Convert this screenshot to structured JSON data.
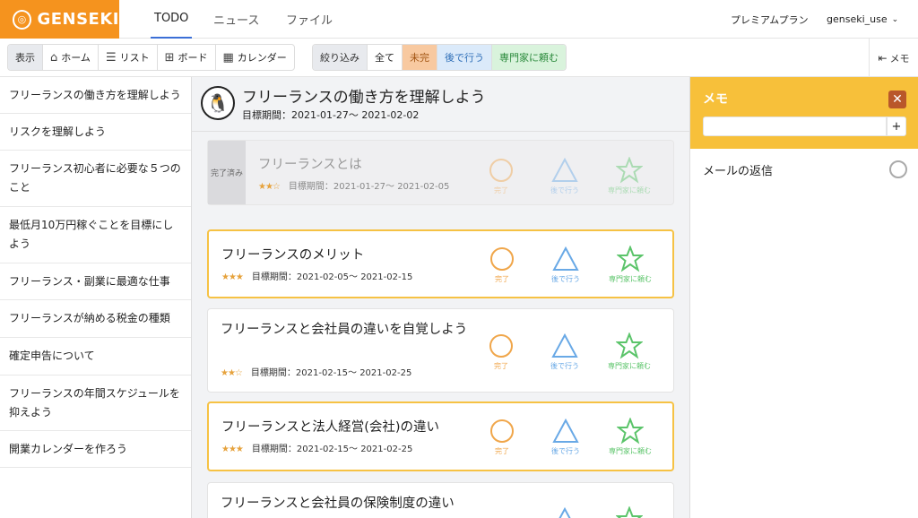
{
  "app": {
    "logo": "GENSEKI"
  },
  "topnav": {
    "items": [
      "TODO",
      "ニュース",
      "ファイル"
    ],
    "plan": "プレミアムプラン",
    "user": "genseki_use"
  },
  "toolbar": {
    "view_label": "表示",
    "views": [
      "ホーム",
      "リスト",
      "ボード",
      "カレンダー"
    ],
    "filter_label": "絞り込み",
    "filters": [
      "全て",
      "未完",
      "後で行う",
      "専門家に頼む"
    ],
    "memo_toggle": "メモ"
  },
  "sidebar": {
    "items": [
      "フリーランスの働き方を理解しよう",
      "リスクを理解しよう",
      "フリーランス初心者に必要な５つのこと",
      "最低月10万円稼ぐことを目標にしよう",
      "フリーランス・副業に最適な仕事",
      "フリーランスが納める税金の種類",
      "確定申告について",
      "フリーランスの年間スケジュールを抑えよう",
      "開業カレンダーを作ろう"
    ]
  },
  "course": {
    "title": "フリーランスの働き方を理解しよう",
    "period": "目標期間：2021-01-27〜 2021-02-02"
  },
  "actions": {
    "done": "完了",
    "later": "後で行う",
    "expert": "専門家に頼む"
  },
  "done_tag": "完了済み",
  "cards": [
    {
      "title": "フリーランスとは",
      "stars": "★★☆",
      "period": "目標期間：2021-01-27〜 2021-02-05"
    },
    {
      "title": "フリーランスのメリット",
      "stars": "★★★",
      "period": "目標期間：2021-02-05〜 2021-02-15"
    },
    {
      "title": "フリーランスと会社員の違いを自覚しよう",
      "stars": "★★☆",
      "period": "目標期間：2021-02-15〜 2021-02-25"
    },
    {
      "title": "フリーランスと法人経営(会社)の違い",
      "stars": "★★★",
      "period": "目標期間：2021-02-15〜 2021-02-25"
    },
    {
      "title": "フリーランスと会社員の保険制度の違い",
      "stars": "",
      "period": ""
    }
  ],
  "memo": {
    "title": "メモ",
    "input_value": "",
    "add": "+",
    "items": [
      "メールの返信"
    ]
  },
  "colors": {
    "brand": "#f5931e",
    "memo_head": "#f7c03a",
    "highlight": "#f6c244",
    "done": "#f0a64a",
    "later": "#69a9e6",
    "expert": "#5bc46a",
    "filter_active": "#f8c9a0"
  }
}
